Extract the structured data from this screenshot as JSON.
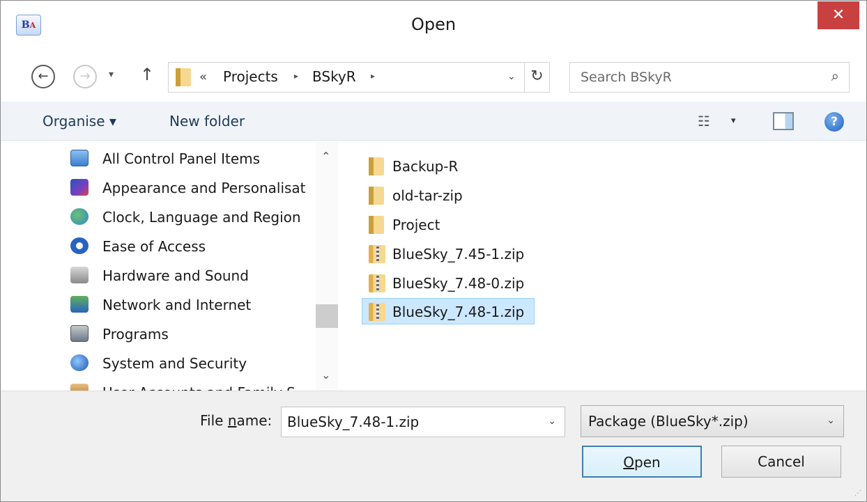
{
  "window": {
    "title": "Open",
    "close_symbol": "✕",
    "app_icon": {
      "main": "B",
      "sub": "A"
    }
  },
  "nav": {
    "back_symbol": "←",
    "forward_symbol": "→",
    "recent_symbol": "▾",
    "up_symbol": "↑",
    "address": {
      "overflow": "«",
      "crumbs": [
        "Projects",
        "BSkyR"
      ],
      "separator": "▸",
      "dropdown_symbol": "⌄",
      "refresh_symbol": "↻"
    },
    "search": {
      "placeholder": "Search BSkyR",
      "icon_symbol": "⌕"
    }
  },
  "toolbar": {
    "organise_label": "Organise ▾",
    "new_folder_label": "New folder",
    "view_symbol": "☷",
    "view_caret": "▾",
    "help_symbol": "?"
  },
  "tree": {
    "items": [
      {
        "label": "All Control Panel Items",
        "icon": "control-panel-icon"
      },
      {
        "label": "Appearance and Personalisat",
        "icon": "appearance-icon"
      },
      {
        "label": "Clock, Language and Region",
        "icon": "globe-clock-icon"
      },
      {
        "label": "Ease of Access",
        "icon": "ease-of-access-icon"
      },
      {
        "label": "Hardware and Sound",
        "icon": "printer-icon"
      },
      {
        "label": "Network and Internet",
        "icon": "network-icon"
      },
      {
        "label": "Programs",
        "icon": "programs-icon"
      },
      {
        "label": "System and Security",
        "icon": "shield-icon"
      },
      {
        "label": "User Accounts and Family S",
        "icon": "users-icon"
      }
    ],
    "scroll_up": "⌃",
    "scroll_down": "⌄"
  },
  "files": {
    "items": [
      {
        "name": "Backup-R",
        "type": "folder"
      },
      {
        "name": "old-tar-zip",
        "type": "folder"
      },
      {
        "name": "Project",
        "type": "folder"
      },
      {
        "name": "BlueSky_7.45-1.zip",
        "type": "zip"
      },
      {
        "name": "BlueSky_7.48-0.zip",
        "type": "zip"
      },
      {
        "name": "BlueSky_7.48-1.zip",
        "type": "zip",
        "selected": true
      }
    ]
  },
  "footer": {
    "file_name_label_pre": "File ",
    "file_name_label_u": "n",
    "file_name_label_post": "ame:",
    "file_name_value": "BlueSky_7.48-1.zip",
    "dropdown_symbol": "⌄",
    "file_type": "Package (BlueSky*.zip)",
    "open_label_u": "O",
    "open_label_rest": "pen",
    "cancel_label": "Cancel",
    "grip_symbol": "⋰"
  }
}
